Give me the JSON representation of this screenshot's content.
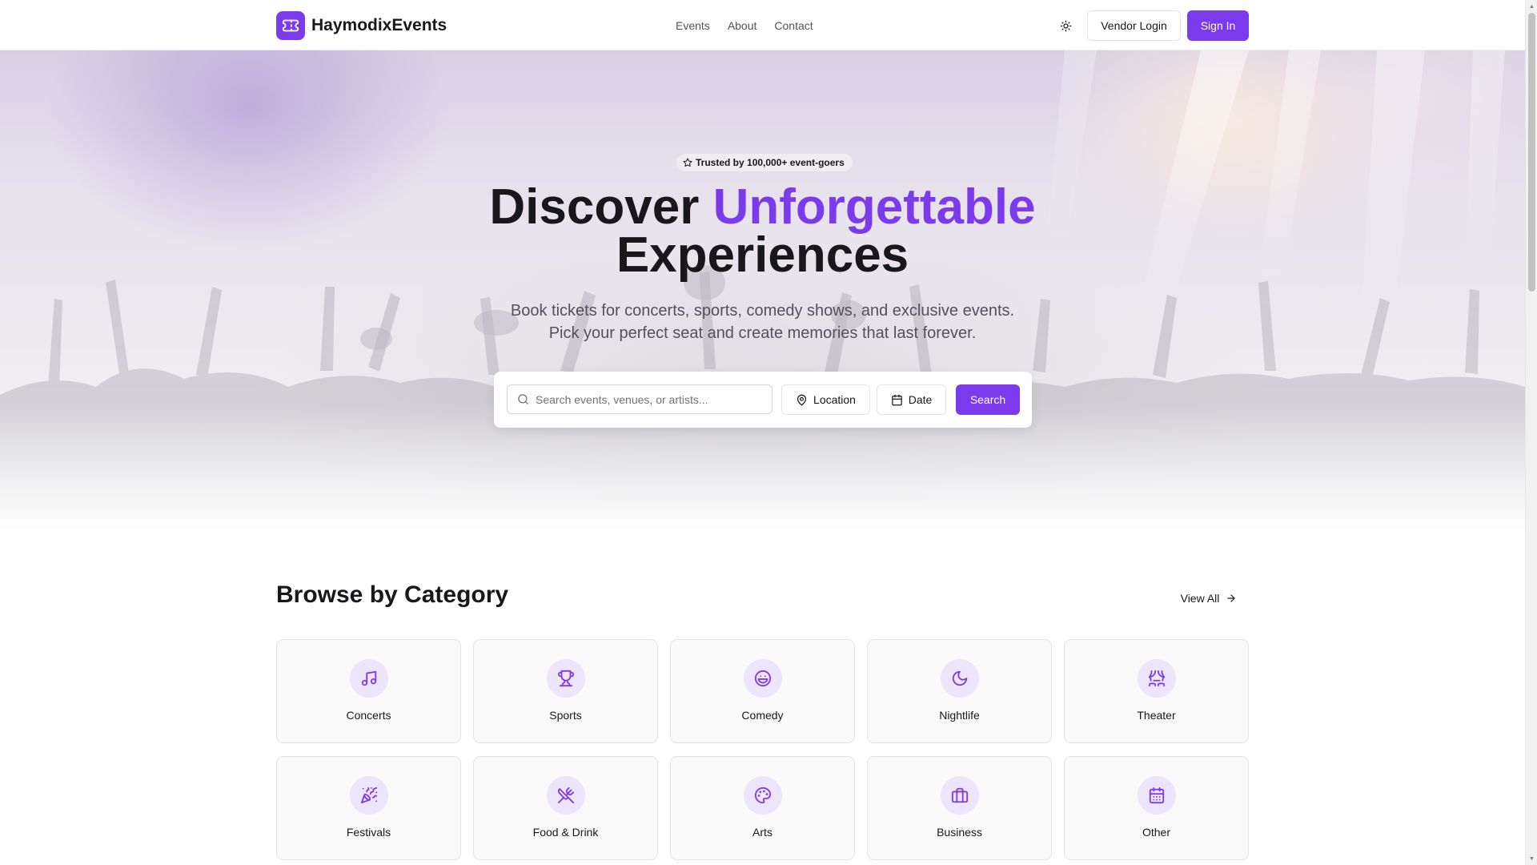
{
  "brand": {
    "name": "HaymodixEvents",
    "logo_icon": "ticket-icon",
    "accent": "#7c3aed"
  },
  "nav": {
    "items": [
      {
        "label": "Events"
      },
      {
        "label": "About"
      },
      {
        "label": "Contact"
      }
    ]
  },
  "header": {
    "theme_icon": "sun-icon",
    "vendor_login": "Vendor Login",
    "sign_in": "Sign In"
  },
  "hero": {
    "badge": "Trusted by 100,000+ event-goers",
    "badge_icon": "star-icon",
    "title_part1": "Discover",
    "title_accent": "Unforgettable",
    "title_part2": "Experiences",
    "subtitle_line1": "Book tickets for concerts, sports, comedy shows, and exclusive events.",
    "subtitle_line2": "Pick your perfect seat and create memories that last forever."
  },
  "search": {
    "placeholder": "Search events, venues, or artists...",
    "value": "",
    "location_label": "Location",
    "date_label": "Date",
    "submit_label": "Search"
  },
  "categories": {
    "title": "Browse by Category",
    "view_all": "View All",
    "items": [
      {
        "label": "Concerts",
        "icon": "music-icon"
      },
      {
        "label": "Sports",
        "icon": "trophy-icon"
      },
      {
        "label": "Comedy",
        "icon": "laugh-icon"
      },
      {
        "label": "Nightlife",
        "icon": "moon-icon"
      },
      {
        "label": "Theater",
        "icon": "theater-icon"
      },
      {
        "label": "Festivals",
        "icon": "party-popper-icon"
      },
      {
        "label": "Food & Drink",
        "icon": "utensils-icon"
      },
      {
        "label": "Arts",
        "icon": "palette-icon"
      },
      {
        "label": "Business",
        "icon": "briefcase-icon"
      },
      {
        "label": "Other",
        "icon": "calendar-icon"
      }
    ]
  }
}
